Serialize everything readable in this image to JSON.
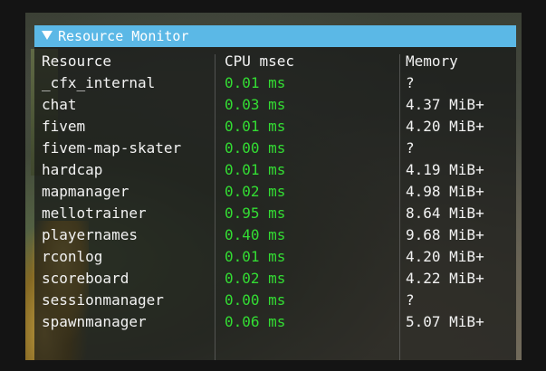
{
  "window": {
    "title": "Resource Monitor"
  },
  "columns": [
    "Resource",
    "CPU msec",
    "Memory"
  ],
  "rows": [
    {
      "resource": "_cfx_internal",
      "cpu": "0.01 ms",
      "memory": "?"
    },
    {
      "resource": "chat",
      "cpu": "0.03 ms",
      "memory": "4.37 MiB+"
    },
    {
      "resource": "fivem",
      "cpu": "0.01 ms",
      "memory": "4.20 MiB+"
    },
    {
      "resource": "fivem-map-skater",
      "cpu": "0.00 ms",
      "memory": "?"
    },
    {
      "resource": "hardcap",
      "cpu": "0.01 ms",
      "memory": "4.19 MiB+"
    },
    {
      "resource": "mapmanager",
      "cpu": "0.02 ms",
      "memory": "4.98 MiB+"
    },
    {
      "resource": "mellotrainer",
      "cpu": "0.95 ms",
      "memory": "8.64 MiB+"
    },
    {
      "resource": "playernames",
      "cpu": "0.40 ms",
      "memory": "9.68 MiB+"
    },
    {
      "resource": "rconlog",
      "cpu": "0.01 ms",
      "memory": "4.20 MiB+"
    },
    {
      "resource": "scoreboard",
      "cpu": "0.02 ms",
      "memory": "4.22 MiB+"
    },
    {
      "resource": "sessionmanager",
      "cpu": "0.00 ms",
      "memory": "?"
    },
    {
      "resource": "spawnmanager",
      "cpu": "0.06 ms",
      "memory": "5.07 MiB+"
    }
  ],
  "colors": {
    "titlebar": "#5bb8e6",
    "cpu_text": "#33dd33",
    "text": "#f2f2f2"
  }
}
